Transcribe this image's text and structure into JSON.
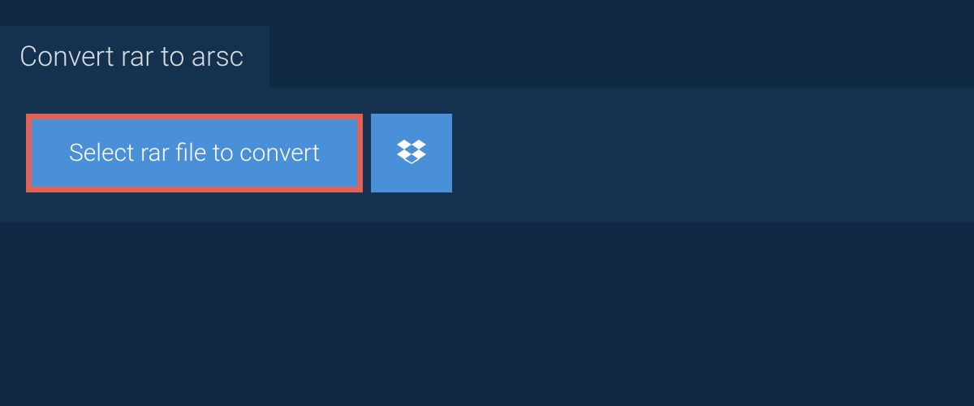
{
  "header": {
    "title": "Convert rar to arsc"
  },
  "actions": {
    "select_file_label": "Select rar file to convert",
    "dropbox_icon": "dropbox-icon"
  },
  "colors": {
    "background": "#0f2a42",
    "panel": "#14324f",
    "button": "#4a90d9",
    "highlight_border": "#e06256",
    "text_light": "#d8dde2",
    "text_white": "#ffffff"
  }
}
